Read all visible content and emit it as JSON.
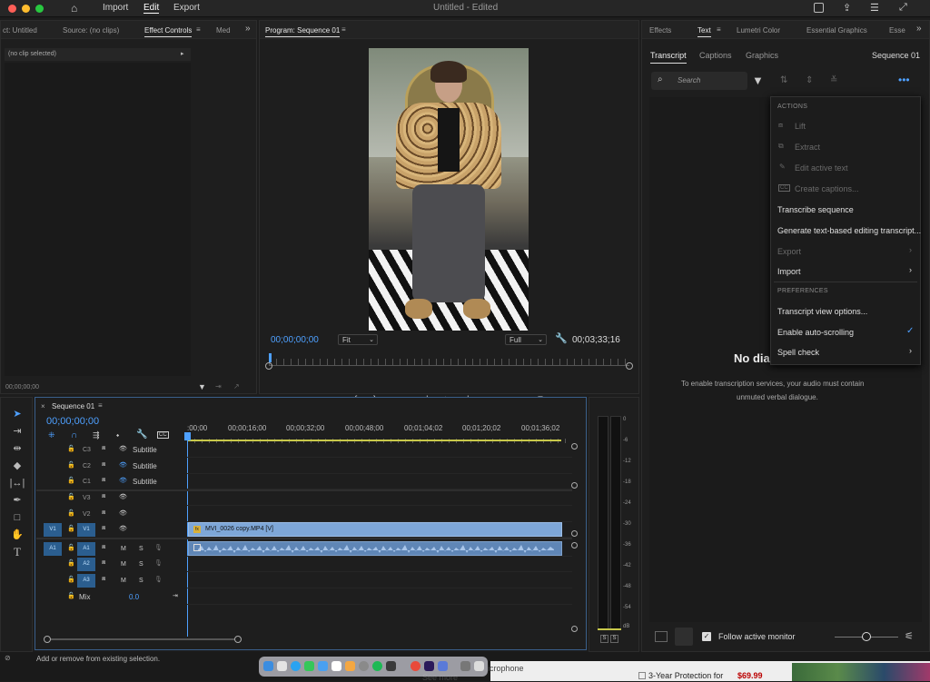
{
  "titlebar": {
    "title": "Untitled - Edited",
    "menu": [
      "Import",
      "Edit",
      "Export"
    ],
    "active_menu": "Edit"
  },
  "source_panel": {
    "tabs": [
      "ct: Untitled",
      "Source: (no clips)",
      "Effect Controls",
      "Med"
    ],
    "active_tab": "Effect Controls",
    "no_clip": "(no clip selected)",
    "timecode": "00;00;00;00"
  },
  "program": {
    "title": "Program: Sequence 01",
    "timecode": "00;00;00;00",
    "fit": "Fit",
    "quality": "Full",
    "duration": "00;03;33;16"
  },
  "text_panel": {
    "tabs": [
      "Effects",
      "Text",
      "Lumetri Color",
      "Essential Graphics",
      "Esse"
    ],
    "active_tab": "Text",
    "subtabs": [
      "Transcript",
      "Captions",
      "Graphics"
    ],
    "active_subtab": "Transcript",
    "sequence_name": "Sequence 01",
    "search_placeholder": "Search",
    "empty_title": "No dial",
    "empty_msg": "To enable transcription services, your audio must contain",
    "empty_msg2": "unmuted verbal dialogue.",
    "follow_label": "Follow active monitor"
  },
  "context_menu": {
    "actions_header": "ACTIONS",
    "lift": "Lift",
    "extract": "Extract",
    "edit_text": "Edit active text",
    "create_captions": "Create captions...",
    "transcribe": "Transcribe sequence",
    "generate": "Generate text-based editing transcript...",
    "export": "Export",
    "import": "Import",
    "preferences_header": "PREFERENCES",
    "view_options": "Transcript view options...",
    "auto_scroll": "Enable auto-scrolling",
    "spell_check": "Spell check"
  },
  "timeline": {
    "tab": "Sequence 01",
    "timecode": "00;00;00;00",
    "ruler": [
      ":00;00",
      "00;00;16;00",
      "00;00;32;00",
      "00;00;48;00",
      "00;01;04;02",
      "00;01;20;02",
      "00;01;36;02"
    ],
    "caption_tracks": [
      {
        "id": "C3",
        "label": "Subtitle"
      },
      {
        "id": "C2",
        "label": "Subtitle"
      },
      {
        "id": "C1",
        "label": "Subtitle"
      }
    ],
    "video_tracks": [
      "V3",
      "V2",
      "V1"
    ],
    "audio_tracks": [
      "A1",
      "A2",
      "A3"
    ],
    "source_v": "V1",
    "source_a": "A1",
    "mix_label": "Mix",
    "mix_value": "0.0",
    "clip_name": "MVI_0026 copy.MP4 [V]",
    "mute_label": "M",
    "solo_label": "S"
  },
  "meter": {
    "scale": [
      "0",
      "-6",
      "-12",
      "-18",
      "-24",
      "-30",
      "-36",
      "-42",
      "-48",
      "-54"
    ],
    "unit": "dB",
    "solo": [
      "S",
      "S"
    ]
  },
  "status": {
    "text": "Add or remove from existing selection."
  },
  "behind": {
    "microphone": "icrophone",
    "see_more": "See more",
    "protection": "3-Year Protection for",
    "price": "$69.99"
  },
  "colors": {
    "accent_blue": "#4ea0ff",
    "clip_blue": "#7ea7d8",
    "audio_blue": "#5f86b6",
    "playhead": "#4ea0ff",
    "yellow": "#c8c84a"
  }
}
